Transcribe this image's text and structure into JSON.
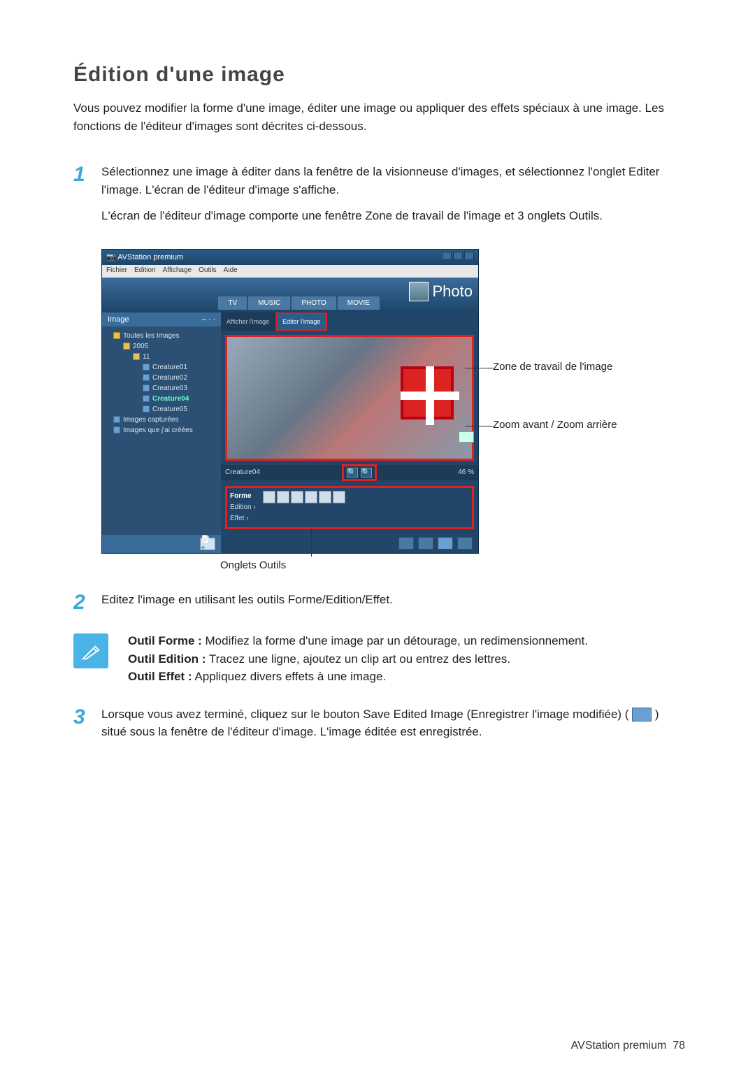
{
  "title": "Édition d'une image",
  "intro": "Vous pouvez modifier la forme d'une image, éditer une image ou appliquer des effets spéciaux à une image. Les fonctions de l'éditeur d'images sont décrites ci-dessous.",
  "steps": {
    "s1_num": "1",
    "s1a": "Sélectionnez une image à éditer dans la fenêtre de la visionneuse d'images, et sélectionnez l'onglet Editer l'image. L'écran de l'éditeur d'image s'affiche.",
    "s1b": "L'écran de l'éditeur d'image comporte une fenêtre Zone de travail de l'image et 3 onglets Outils.",
    "s2_num": "2",
    "s2": "Editez l'image en utilisant les outils Forme/Edition/Effet.",
    "s3_num": "3",
    "s3a": "Lorsque vous avez terminé, cliquez sur le bouton Save Edited Image (Enregistrer l'image modifiée) ( ",
    "s3b": " ) situé sous la fenêtre de l'éditeur d'image. L'image éditée est enregistrée."
  },
  "callouts": {
    "work": "Zone de travail de l'image",
    "zoom": "Zoom avant / Zoom arrière",
    "tools": "Onglets Outils"
  },
  "note": {
    "forme_label": "Outil Forme :",
    "forme": " Modifiez la forme d'une image par un détourage, un redimensionnement.",
    "edition_label": "Outil Edition :",
    "edition": " Tracez une ligne, ajoutez un clip art ou entrez des lettres.",
    "effet_label": "Outil Effet :",
    "effet": " Appliquez divers effets à une image."
  },
  "app": {
    "title": "AVStation premium",
    "menus": [
      "Fichier",
      "Edition",
      "Affichage",
      "Outils",
      "Aide"
    ],
    "topTabs": [
      "TV",
      "MUSIC",
      "PHOTO",
      "MOVIE"
    ],
    "photo": "Photo",
    "sideHead": "Image",
    "tree": {
      "root": "Toutes les Images",
      "year": "2005",
      "day": "11",
      "items": [
        "Creature01",
        "Creature02",
        "Creature03",
        "Creature04",
        "Creature05"
      ],
      "captured": "Images capturées",
      "created": "Images que j'ai créées"
    },
    "subtabs": {
      "view": "Afficher l'image",
      "edit": "Editer l'image"
    },
    "filename": "Creature04",
    "zoomPct": "46 %",
    "tool": {
      "forme": "Forme",
      "edition": "Edition ›",
      "effet": "Effet ›"
    },
    "addBtn": "📄+"
  },
  "footer": {
    "section": "AVStation premium",
    "page": "78"
  }
}
